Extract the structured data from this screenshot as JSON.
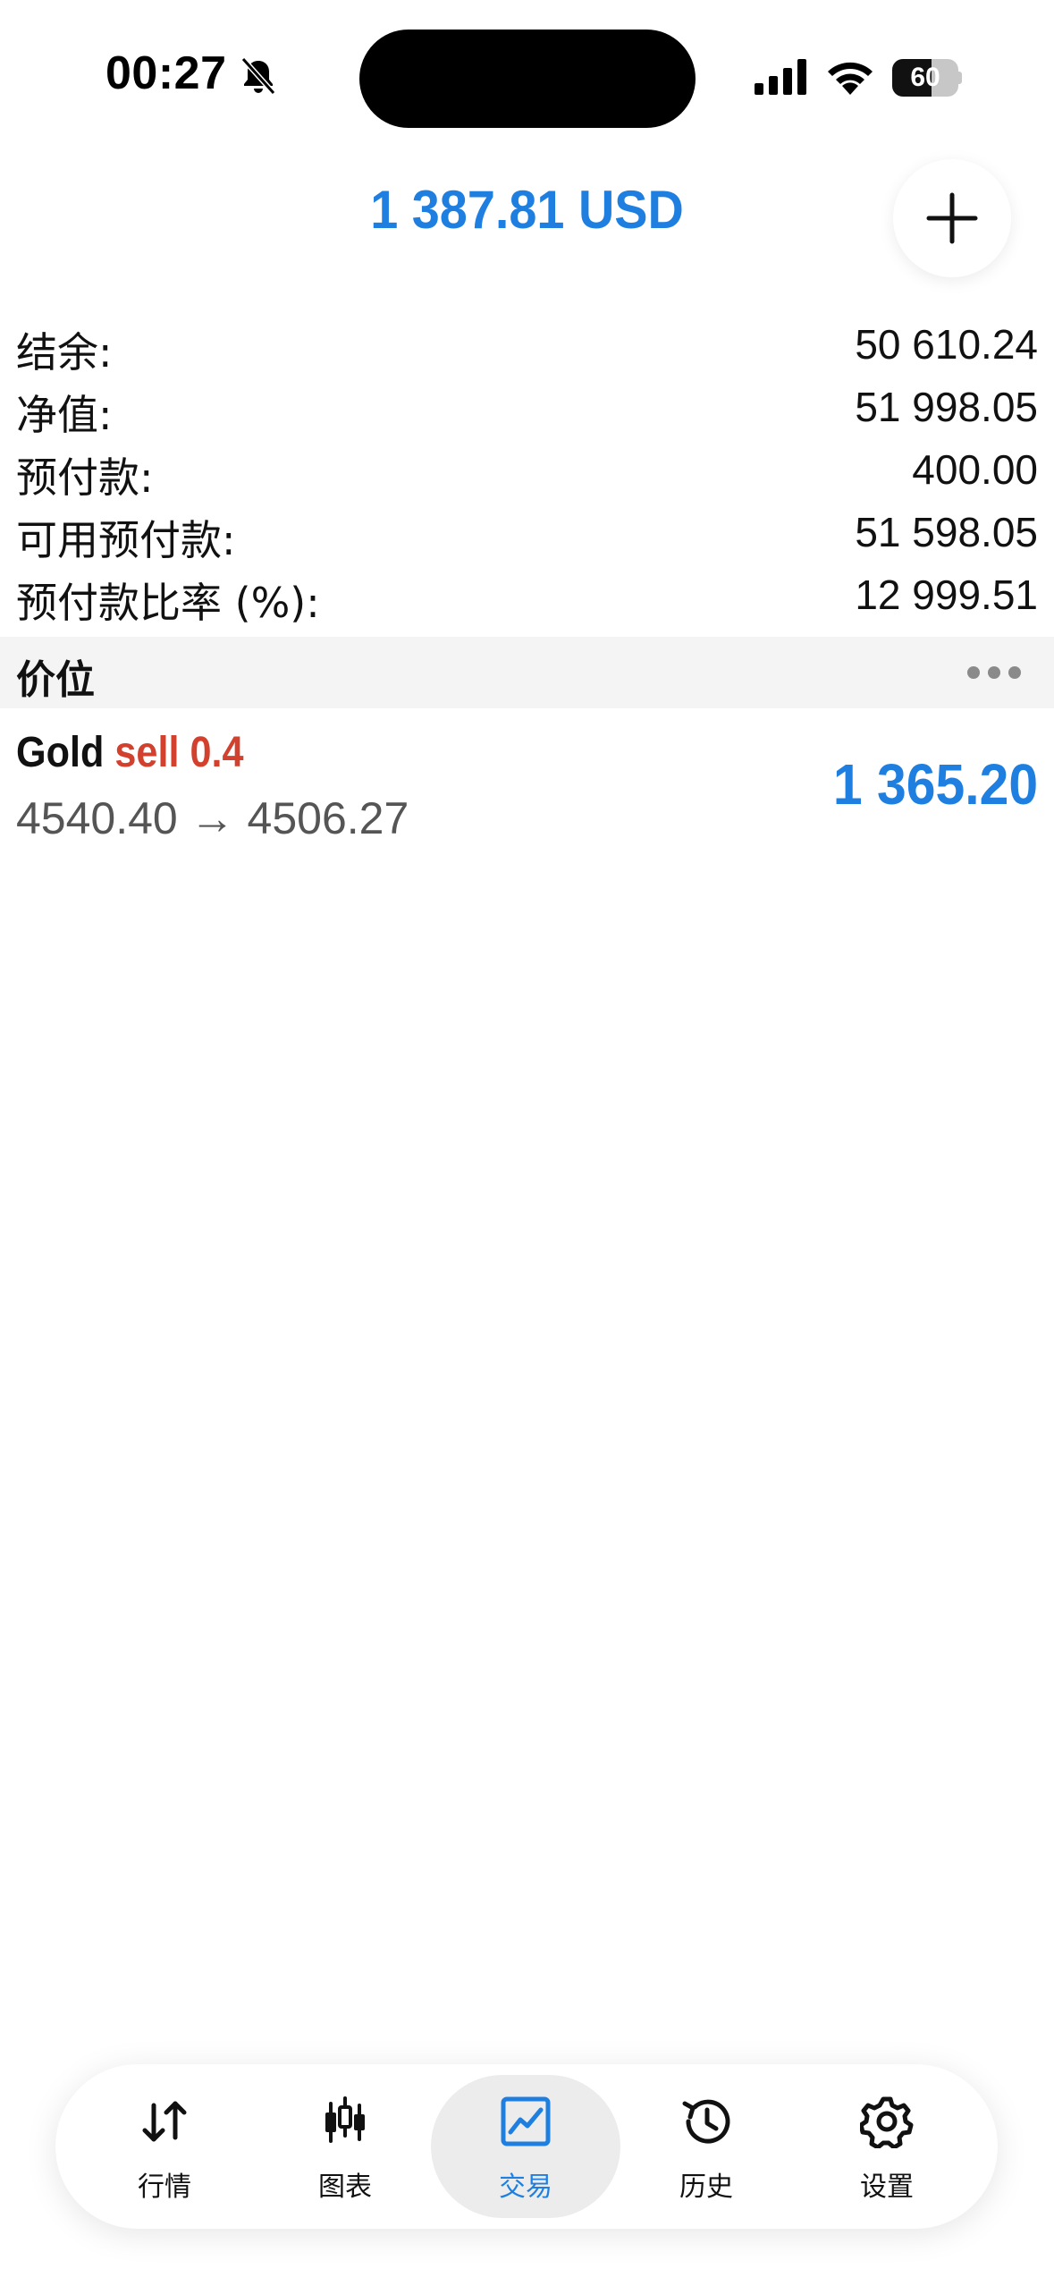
{
  "status_bar": {
    "time": "00:27",
    "battery_level": "60",
    "battery_fraction": 0.6
  },
  "header": {
    "total": "1 387.81 USD",
    "add_icon": "plus-icon"
  },
  "summary": {
    "rows": [
      {
        "label": "结余:",
        "value": "50 610.24"
      },
      {
        "label": "净值:",
        "value": "51 998.05"
      },
      {
        "label": "预付款:",
        "value": "400.00"
      },
      {
        "label": "可用预付款:",
        "value": "51 598.05"
      },
      {
        "label": "预付款比率 (%):",
        "value": "12 999.51"
      }
    ]
  },
  "positions_section": {
    "title": "价位",
    "more_icon": "more-dots-icon"
  },
  "positions": [
    {
      "symbol": "Gold",
      "side": "sell 0.4",
      "prices": "4540.40 → 4506.27",
      "profit": "1 365.20"
    }
  ],
  "tab_bar": {
    "tabs": [
      {
        "label": "行情",
        "icon": "quotes-arrows-icon"
      },
      {
        "label": "图表",
        "icon": "candlestick-chart-icon"
      },
      {
        "label": "交易",
        "icon": "trade-chart-icon"
      },
      {
        "label": "历史",
        "icon": "history-clock-icon"
      },
      {
        "label": "设置",
        "icon": "settings-gear-icon"
      }
    ],
    "active_index": 2
  },
  "colors": {
    "accent_blue": "#1e7fe0",
    "sell_red": "#d2402e",
    "section_bg": "#f4f4f4"
  }
}
